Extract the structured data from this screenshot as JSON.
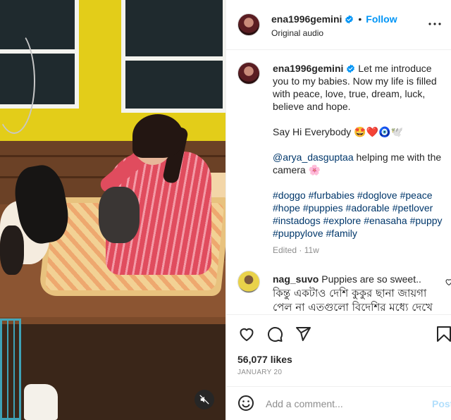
{
  "post": {
    "username": "ena1996gemini",
    "follow_label": "Follow",
    "audio_label": "Original audio",
    "dot": "•"
  },
  "caption": {
    "line1_prefix": "Let me introduce you to my babies. Now my life is filled with peace, love, true, dream, luck, believe and hope.",
    "line2": "Say Hi Everybody 🤩❤️🧿🕊️",
    "mention": "@arya_dasguptaa",
    "line3_suffix": " helping me with the camera 🌸",
    "hashtags": [
      "#doggo",
      "#furbabies",
      "#doglove",
      "#peace",
      "#hope",
      "#puppies",
      "#adorable",
      "#petlover",
      "#instadogs",
      "#explore",
      "#enasaha",
      "#puppy",
      "#puppylove",
      "#family"
    ],
    "edited": "Edited · 11w"
  },
  "comment": {
    "username": "nag_suvo",
    "text": "Puppies are so sweet..",
    "bengali": "কিন্তু একটাও দেশি কুকুর ছানা জায়গা পেল না এতগুলো বিদেশির মধ্যে দেখে"
  },
  "stats": {
    "likes": "56,077 likes",
    "date": "JANUARY 20"
  },
  "composer": {
    "placeholder": "Add a comment...",
    "post_label": "Post"
  },
  "icons": {
    "verified": "verified-badge-icon",
    "more": "more-options-icon",
    "like": "heart-icon",
    "comment": "comment-icon",
    "share": "share-icon",
    "save": "bookmark-icon",
    "emoji": "emoji-icon",
    "mute": "mute-icon"
  },
  "colors": {
    "accent": "#0095f6",
    "link": "#00376b",
    "muted": "#8e8e8e"
  }
}
